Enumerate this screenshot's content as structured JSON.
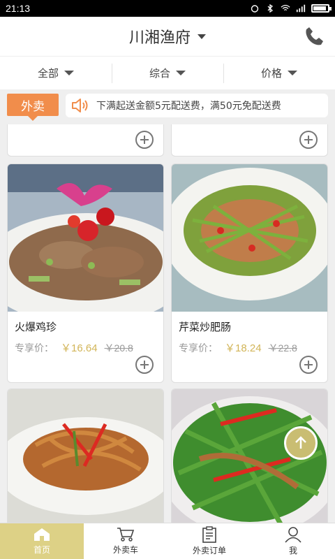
{
  "status": {
    "time": "21:13"
  },
  "header": {
    "title": "川湘渔府"
  },
  "filters": [
    {
      "label": "全部"
    },
    {
      "label": "综合"
    },
    {
      "label": "价格"
    }
  ],
  "notice": {
    "tag": "外卖",
    "text": "下满起送金额5元配送费，满50元免配送费"
  },
  "dishes": [
    {
      "name": "火爆鸡珍",
      "price_label": "专享价：",
      "price": "￥16.64",
      "old_price": "￥20.8"
    },
    {
      "name": "芹菜炒肥肠",
      "price_label": "专享价：",
      "price": "￥18.24",
      "old_price": "￥22.8"
    }
  ],
  "nav": [
    {
      "label": "首页"
    },
    {
      "label": "外卖车"
    },
    {
      "label": "外卖订单"
    },
    {
      "label": "我"
    }
  ],
  "colors": {
    "accent": "#ddd186",
    "price": "#d2b558",
    "tag": "#f18d4b"
  }
}
